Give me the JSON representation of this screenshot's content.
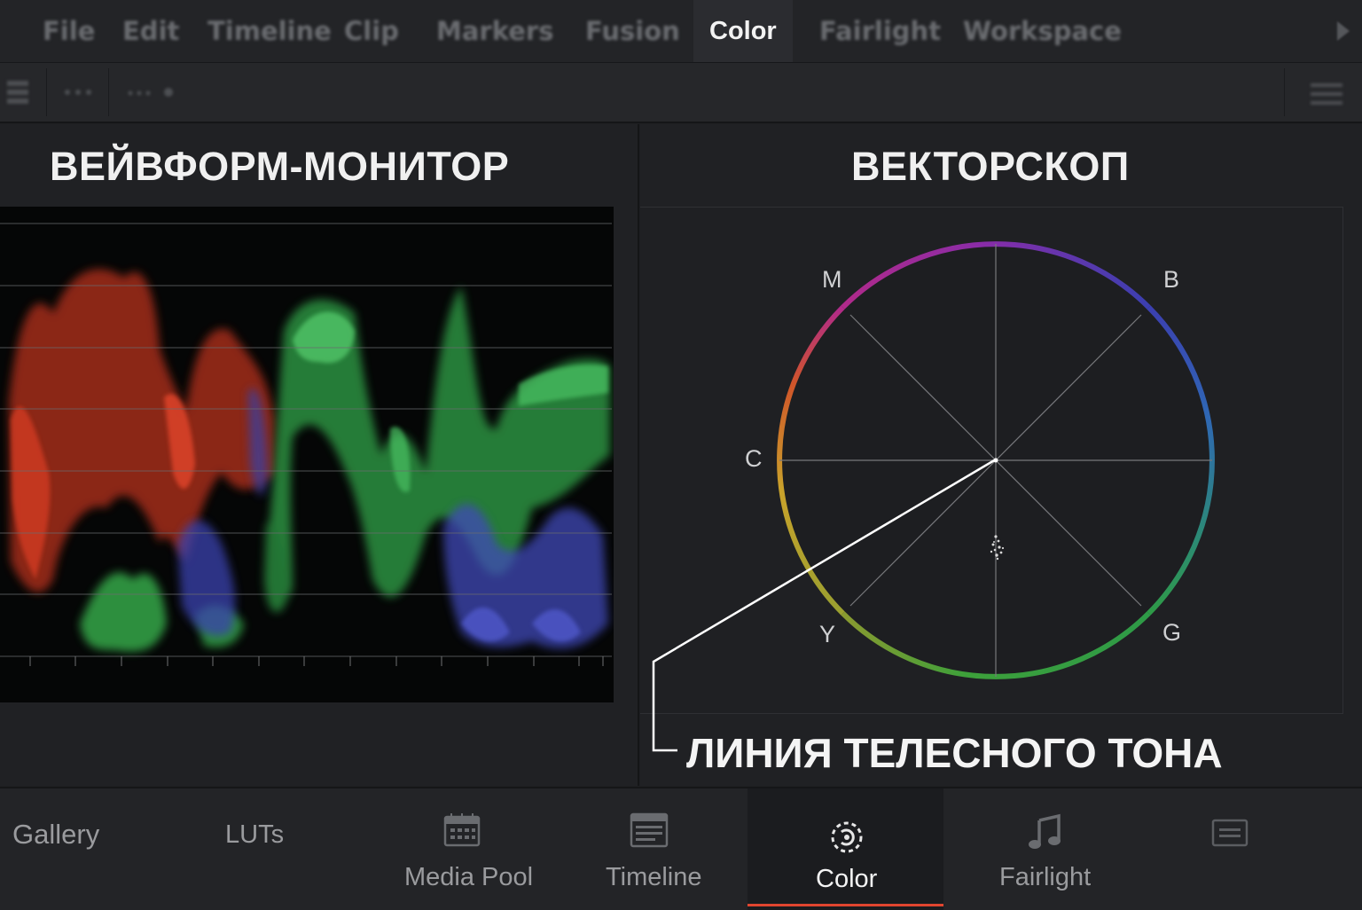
{
  "menubar": {
    "items": [
      "File",
      "Edit",
      "Timeline",
      "Clip",
      "Markers",
      "Fusion",
      "Color",
      "Fairlight",
      "Workspace"
    ],
    "active": "Color"
  },
  "panels": {
    "waveform_title": "ВЕЙВФОРМ-МОНИТОР",
    "vectorscope_title": "ВЕКТОРСКОП"
  },
  "vectorscope": {
    "targets": {
      "m": "M",
      "b": "B",
      "c": "C",
      "y": "Y",
      "g": "G"
    }
  },
  "annotation": {
    "skin_tone_line": "ЛИНИЯ ТЕЛЕСНОГО ТОНА"
  },
  "bottombar": {
    "gallery": "Gallery",
    "luts": "LUTs",
    "media_pool": "Media Pool",
    "timeline": "Timeline",
    "color": "Color",
    "fairlight": "Fairlight",
    "active": "Color",
    "accent_color": "#e0452f"
  },
  "icons": {
    "media_pool": "media-pool-icon",
    "timeline": "timeline-icon",
    "color": "color-wheel-icon",
    "fairlight": "music-note-icon",
    "deliver": "deliver-icon"
  }
}
